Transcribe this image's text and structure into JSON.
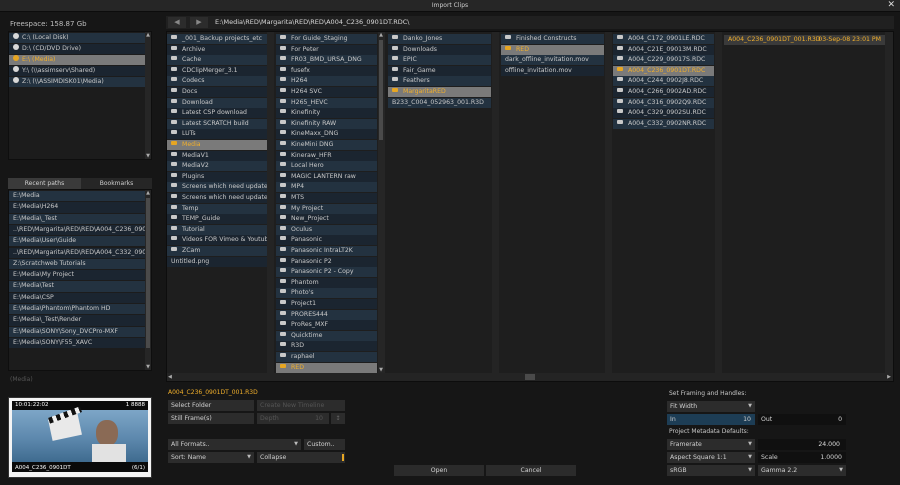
{
  "window": {
    "title": "Import Clips",
    "close": "✕"
  },
  "freespace": "Freespace: 158.87 Gb",
  "drives": [
    {
      "label": "C:\\ (Local Disk)",
      "selected": false
    },
    {
      "label": "D:\\ (CD/DVD Drive)",
      "selected": false
    },
    {
      "label": "E:\\ (Media)",
      "selected": true
    },
    {
      "label": "Y:\\ (\\\\assimserv\\Shared)",
      "selected": false
    },
    {
      "label": "Z:\\ (\\\\ASSIMDISK01\\Media)",
      "selected": false
    }
  ],
  "tabs": {
    "recent": "Recent paths",
    "bookmarks": "Bookmarks"
  },
  "recent_paths": [
    "E:\\Media",
    "E:\\Media\\H264",
    "E:\\Media\\_Test",
    "..\\RED\\Margarita\\RED\\RED\\A004_C236_0901DT.RDC",
    "E:\\Media\\User\\Guide",
    "..\\RED\\Margarita\\RED\\RED\\A004_C332_0902NR.RDC",
    "Z:\\Scratchweb Tutorials",
    "E:\\Media\\My Project",
    "E:\\Media\\Test",
    "E:\\Media\\CSP",
    "E:\\Media\\Phantom\\Phantom HD",
    "E:\\Media\\_Test\\Render",
    "E:\\Media\\SONY\\Sony_DVCPro-MXF",
    "E:\\Media\\SONY\\F55_XAVC"
  ],
  "status_label": "(Media)",
  "preview": {
    "timecode": "10:01:22:02",
    "frame": "1 8888",
    "clip_name": "A004_C236_0901DT",
    "count": "(6/1)"
  },
  "path": "E:\\Media\\RED\\Margarita\\RED\\RED\\A004_C236_0901DT.RDC\\",
  "nav": {
    "back": "◀",
    "forward": "▶"
  },
  "columns": [
    [
      {
        "name": "_001_Backup projects_etc",
        "folder": true
      },
      {
        "name": "Archive",
        "folder": true
      },
      {
        "name": "Cache",
        "folder": true
      },
      {
        "name": "CDClipMerger_3.1",
        "folder": true
      },
      {
        "name": "Codecs",
        "folder": true
      },
      {
        "name": "Docs",
        "folder": true
      },
      {
        "name": "Download",
        "folder": true
      },
      {
        "name": "Latest CSP download",
        "folder": true
      },
      {
        "name": "Latest SCRATCH build",
        "folder": true
      },
      {
        "name": "LUTs",
        "folder": true
      },
      {
        "name": "Media",
        "folder": true,
        "selected": true
      },
      {
        "name": "MediaV1",
        "folder": true
      },
      {
        "name": "MediaV2",
        "folder": true
      },
      {
        "name": "Plugins",
        "folder": true
      },
      {
        "name": "Screens which need update in ...",
        "folder": true
      },
      {
        "name": "Screens which need update in ...",
        "folder": true
      },
      {
        "name": "Temp",
        "folder": true
      },
      {
        "name": "TEMP_Guide",
        "folder": true
      },
      {
        "name": "Tutorial",
        "folder": true
      },
      {
        "name": "Videos FOR Vimeo & Youtube",
        "folder": true
      },
      {
        "name": "ZCam",
        "folder": true
      },
      {
        "name": "Untitled.png",
        "folder": false
      }
    ],
    [
      {
        "name": "For Guide_Staging",
        "folder": true
      },
      {
        "name": "For Peter",
        "folder": true
      },
      {
        "name": "FR03_BMD_URSA_DNG",
        "folder": true
      },
      {
        "name": "fusefx",
        "folder": true
      },
      {
        "name": "H264",
        "folder": true
      },
      {
        "name": "H264 SVC",
        "folder": true
      },
      {
        "name": "H265_HEVC",
        "folder": true
      },
      {
        "name": "Kinefinity",
        "folder": true
      },
      {
        "name": "Kinefinity RAW",
        "folder": true
      },
      {
        "name": "KineMaxx_DNG",
        "folder": true
      },
      {
        "name": "KineMini DNG",
        "folder": true
      },
      {
        "name": "Kineraw_HFR",
        "folder": true
      },
      {
        "name": "Local Hero",
        "folder": true
      },
      {
        "name": "MAGIC LANTERN raw",
        "folder": true
      },
      {
        "name": "MP4",
        "folder": true
      },
      {
        "name": "MTS",
        "folder": true
      },
      {
        "name": "My Project",
        "folder": true
      },
      {
        "name": "New_Project",
        "folder": true
      },
      {
        "name": "Oculus",
        "folder": true
      },
      {
        "name": "Panasonic",
        "folder": true
      },
      {
        "name": "Panasonic IntraLT2K",
        "folder": true
      },
      {
        "name": "Panasonic P2",
        "folder": true
      },
      {
        "name": "Panasonic P2 - Copy",
        "folder": true
      },
      {
        "name": "Phantom",
        "folder": true
      },
      {
        "name": "Photo's",
        "folder": true
      },
      {
        "name": "Project1",
        "folder": true
      },
      {
        "name": "PRORES444",
        "folder": true
      },
      {
        "name": "ProRes_MXF",
        "folder": true
      },
      {
        "name": "Quicktime",
        "folder": true
      },
      {
        "name": "R3D",
        "folder": true
      },
      {
        "name": "raphael",
        "folder": true
      },
      {
        "name": "RED",
        "folder": true,
        "selected": true
      }
    ],
    [
      {
        "name": "Danko_Jones",
        "folder": true
      },
      {
        "name": "Downloads",
        "folder": true
      },
      {
        "name": "EPIC",
        "folder": true
      },
      {
        "name": "Fair_Game",
        "folder": true
      },
      {
        "name": "Feathers",
        "folder": true
      },
      {
        "name": "MargaritaRED",
        "folder": true,
        "selected": true
      },
      {
        "name": "B233_C004_052963_001.R3D",
        "folder": false
      }
    ],
    [
      {
        "name": "Finished Constructs",
        "folder": true
      },
      {
        "name": "RED",
        "folder": true,
        "selected": true
      },
      {
        "name": "dark_offline_invitation.mov",
        "folder": false
      },
      {
        "name": "offline_invitation.mov",
        "folder": false
      }
    ],
    [
      {
        "name": "A004_C172_0901LE.RDC",
        "folder": true
      },
      {
        "name": "A004_C21E_09013M.RDC",
        "folder": true
      },
      {
        "name": "A004_C229_09017S.RDC",
        "folder": true
      },
      {
        "name": "A004_C236_0901DT.RDC",
        "folder": true,
        "selected": true
      },
      {
        "name": "A004_C244_0902J8.RDC",
        "folder": true
      },
      {
        "name": "A004_C266_0902AD.RDC",
        "folder": true
      },
      {
        "name": "A004_C316_0902Q9.RDC",
        "folder": true
      },
      {
        "name": "A004_C329_0902SU.RDC",
        "folder": true
      },
      {
        "name": "A004_C332_0902NR.RDC",
        "folder": true
      }
    ]
  ],
  "file_selected": {
    "name": "A004_C236_0901DT_001.R3D",
    "date": "03-Sep-08 23:01 PM"
  },
  "selected_file_label": "A004_C236_0901DT_001.R3D",
  "controls": {
    "select_folder": "Select Folder",
    "create_timeline": "Create New Timeline",
    "still_frames": "Still Frame(s)",
    "depth_label": "Depth",
    "depth_value": "10",
    "formats": "All Formats..",
    "custom": "Custom..",
    "sort": "Sort: Name",
    "collapse": "Collapse",
    "open": "Open",
    "cancel": "Cancel"
  },
  "framing": {
    "title": "Set Framing and Handles:",
    "mode": "Fit Width",
    "in_label": "In",
    "in_value": "10",
    "out_label": "Out",
    "out_value": "0"
  },
  "metadata": {
    "title": "Project Metadata Defaults:",
    "framerate_label": "Framerate",
    "framerate_value": "24.000",
    "aspect_label": "Aspect Square 1:1",
    "scale_label": "Scale",
    "scale_value": "1.0000",
    "colorspace": "sRGB",
    "gamma": "Gamma 2.2"
  },
  "colors": {
    "accent": "#e6a623",
    "row_odd": "#233240",
    "row_even": "#1b2530",
    "selected": "#7a7a7a"
  }
}
